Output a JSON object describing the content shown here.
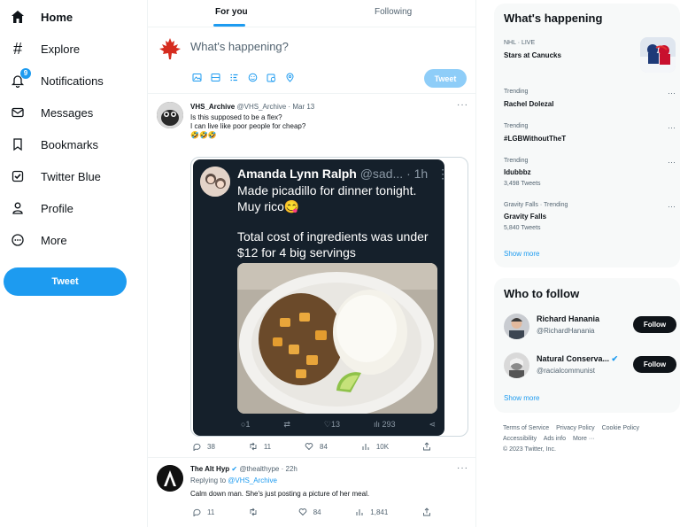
{
  "nav": {
    "items": [
      {
        "label": "Home",
        "icon": "home-icon"
      },
      {
        "label": "Explore",
        "icon": "hashtag-icon"
      },
      {
        "label": "Notifications",
        "icon": "bell-icon",
        "badge": "9"
      },
      {
        "label": "Messages",
        "icon": "mail-icon"
      },
      {
        "label": "Bookmarks",
        "icon": "bookmark-icon"
      },
      {
        "label": "Twitter Blue",
        "icon": "twitter-blue-icon"
      },
      {
        "label": "Profile",
        "icon": "person-icon"
      },
      {
        "label": "More",
        "icon": "more-circle-icon"
      }
    ],
    "tweet_button": "Tweet"
  },
  "timeline": {
    "tabs": [
      "For you",
      "Following"
    ],
    "composer": {
      "placeholder": "What's happening?",
      "tweet_button": "Tweet"
    },
    "tweet1": {
      "name": "VHS_Archive",
      "handle": "@VHS_Archive",
      "time": "Mar 13",
      "lines": [
        "Is this supposed to be a flex?",
        "I can live like poor people for cheap?",
        "🤣🤣🤣"
      ],
      "embed": {
        "name": "Amanda Lynn Ralph",
        "handle": "@sad...",
        "time": "1h",
        "text1": "Made picadillo for dinner tonight.",
        "text2": "Muy rico😋",
        "text3": "Total cost of ingredients was under $12 for 4 big servings",
        "stats": {
          "replies": "1",
          "likes": "13",
          "views": "293"
        }
      },
      "stats": {
        "replies": "38",
        "retweets": "11",
        "likes": "84",
        "views": "10K"
      }
    },
    "tweet2": {
      "name": "The Alt Hyp",
      "handle": "@thealthype",
      "time": "22h",
      "replying_prefix": "Replying to",
      "replying_to": "@VHS_Archive",
      "text": "Calm down man. She's just posting a picture of her meal.",
      "stats": {
        "replies": "11",
        "retweets": "",
        "likes": "84",
        "views": "1,841"
      }
    }
  },
  "whats_happening": {
    "title": "What's happening",
    "trends": [
      {
        "meta": "NHL · LIVE",
        "name": "Stars at Canucks",
        "count": ""
      },
      {
        "meta": "Trending",
        "name": "Rachel Dolezal",
        "count": ""
      },
      {
        "meta": "Trending",
        "name": "#LGBWithoutTheT",
        "count": ""
      },
      {
        "meta": "Trending",
        "name": "Idubbbz",
        "count": "3,498 Tweets"
      },
      {
        "meta": "Gravity Falls · Trending",
        "name": "Gravity Falls",
        "count": "5,840 Tweets"
      }
    ],
    "show_more": "Show more"
  },
  "who_to_follow": {
    "title": "Who to follow",
    "accounts": [
      {
        "name": "Richard Hanania",
        "handle": "@RichardHanania",
        "button": "Follow"
      },
      {
        "name": "Natural Conserva...",
        "handle": "@racialcommunist",
        "button": "Follow"
      }
    ],
    "show_more": "Show more"
  },
  "footer": {
    "links": [
      "Terms of Service",
      "Privacy Policy",
      "Cookie Policy",
      "Accessibility",
      "Ads info",
      "More ···"
    ],
    "copyright": "© 2023 Twitter, Inc."
  },
  "colors": {
    "accent": "#1d9bf0",
    "text": "#0f1419",
    "muted": "#536471",
    "panel": "#f7f9f9"
  }
}
